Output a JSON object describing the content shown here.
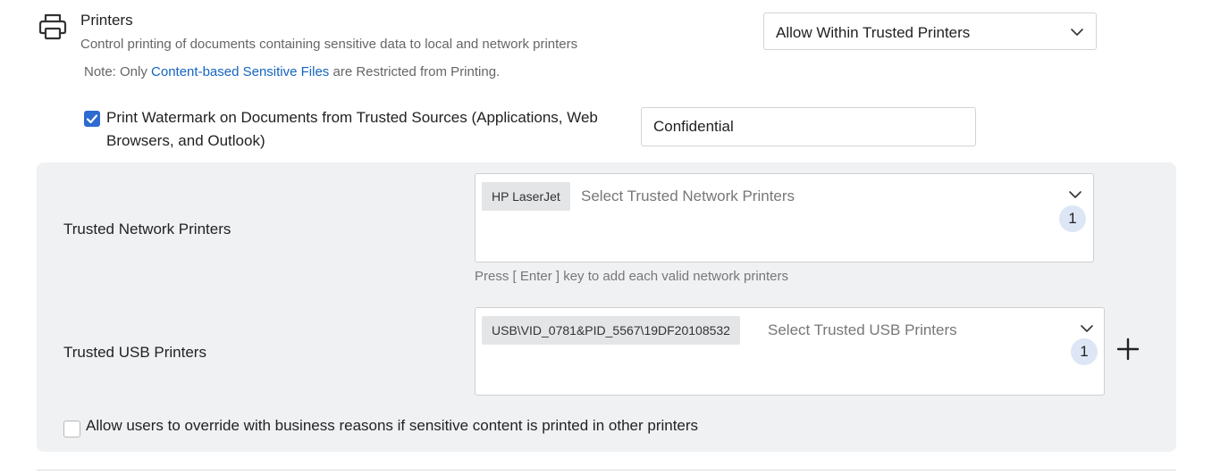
{
  "section": {
    "title": "Printers",
    "description": "Control printing of documents containing sensitive data to local and network printers",
    "note_prefix": "Note: Only ",
    "note_link": "Content-based Sensitive Files",
    "note_suffix": " are Restricted from Printing.",
    "icon": "printer-icon"
  },
  "policy_select": {
    "value": "Allow Within Trusted Printers"
  },
  "watermark": {
    "checked": true,
    "label": "Print Watermark on Documents from Trusted Sources (Applications, Web Browsers, and Outlook)",
    "value": "Confidential"
  },
  "network_printers": {
    "label": "Trusted Network Printers",
    "chip": "HP LaserJet",
    "placeholder": "Select Trusted Network Printers",
    "count": "1",
    "hint": "Press [ Enter ] key to add each valid network printers"
  },
  "usb_printers": {
    "label": "Trusted USB Printers",
    "chip": "USB\\VID_0781&PID_5567\\19DF20108532",
    "placeholder": "Select Trusted USB Printers",
    "count": "1"
  },
  "override": {
    "checked": false,
    "label": "Allow users to override with business reasons if sensitive content is printed in other printers"
  },
  "colors": {
    "accent": "#2d6bd1",
    "link": "#1565c0",
    "panel": "#f0f1f3",
    "badge": "#dde6f4"
  }
}
